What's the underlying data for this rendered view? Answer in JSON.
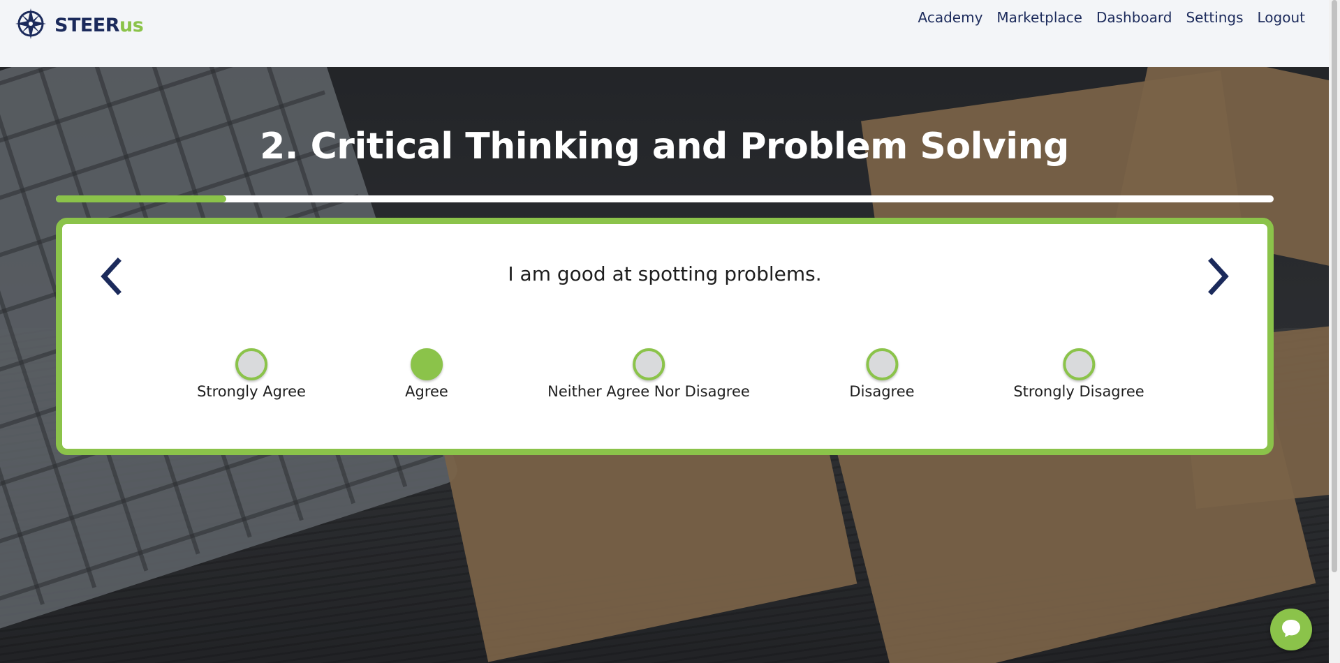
{
  "brand": {
    "name_part1": "STEER",
    "name_part2": "us",
    "primary_color": "#1b2a5b",
    "accent_color": "#8bc34a"
  },
  "nav": {
    "items": [
      "Academy",
      "Marketplace",
      "Dashboard",
      "Settings",
      "Logout"
    ]
  },
  "section": {
    "title": "2. Critical Thinking and Problem Solving",
    "progress_fraction": 0.14
  },
  "question": {
    "text": "I am good at spotting problems."
  },
  "options": [
    {
      "label": "Strongly Agree",
      "selected": false
    },
    {
      "label": "Agree",
      "selected": true
    },
    {
      "label": "Neither Agree Nor Disagree",
      "selected": false
    },
    {
      "label": "Disagree",
      "selected": false
    },
    {
      "label": "Strongly Disagree",
      "selected": false
    }
  ],
  "icons": {
    "logo": "compass-icon",
    "prev": "chevron-left-icon",
    "next": "chevron-right-icon",
    "chat": "chat-bubble-icon"
  }
}
